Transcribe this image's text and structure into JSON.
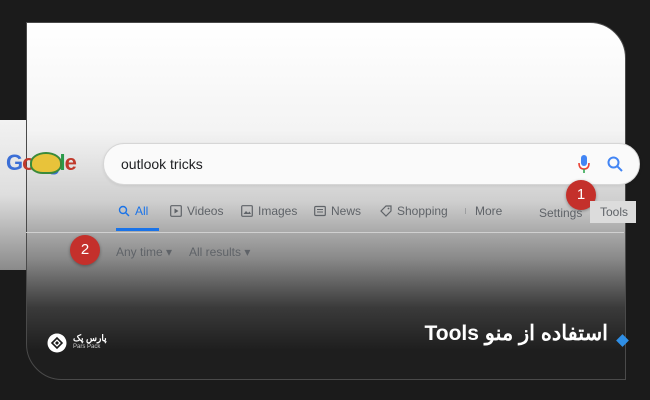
{
  "google": {
    "logo_text": "Google",
    "search_query": "outlook tricks",
    "tabs": [
      {
        "label": "All",
        "icon": "search-icon"
      },
      {
        "label": "Videos",
        "icon": "play-icon"
      },
      {
        "label": "Images",
        "icon": "image-icon"
      },
      {
        "label": "News",
        "icon": "newspaper-icon"
      },
      {
        "label": "Shopping",
        "icon": "tag-icon"
      },
      {
        "label": "More",
        "icon": "more-vertical-icon"
      }
    ],
    "settings_label": "Settings",
    "tools_label": "Tools",
    "filters": {
      "time": "Any time ▾",
      "results": "All results ▾"
    },
    "active_tab_color": "#1a73e8"
  },
  "annotations": {
    "badge1": "1",
    "badge2": "2",
    "badge_color": "#c4302b"
  },
  "caption": "استفاده از منو Tools",
  "brand": {
    "name": "پارس پک",
    "latin": "Pars Pack"
  }
}
